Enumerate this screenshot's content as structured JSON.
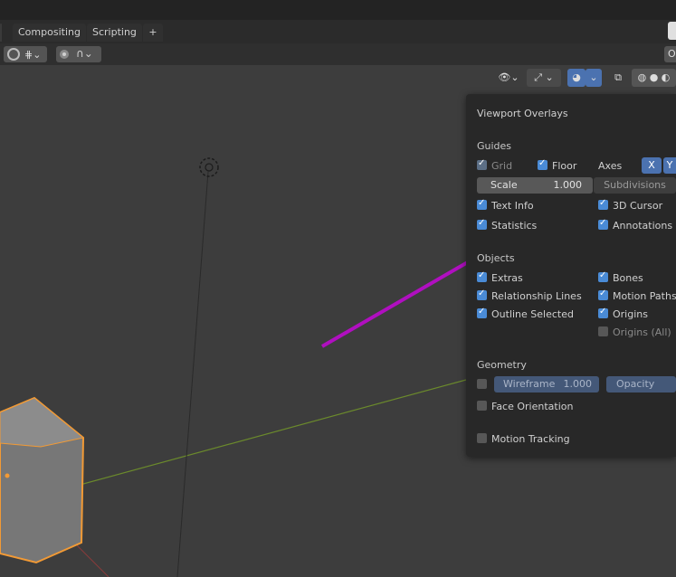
{
  "tabs": [
    "Compositing",
    "Scripting",
    "+"
  ],
  "toolbar": {
    "right_label": "O"
  },
  "overlays": {
    "title": "Viewport Overlays",
    "guides": {
      "header": "Guides",
      "grid": "Grid",
      "floor": "Floor",
      "axes": "Axes",
      "axis_x": "X",
      "axis_y": "Y",
      "scale_label": "Scale",
      "scale_value": "1.000",
      "subdivisions": "Subdivisions",
      "text_info": "Text Info",
      "cursor_3d": "3D Cursor",
      "statistics": "Statistics",
      "annotations": "Annotations"
    },
    "objects": {
      "header": "Objects",
      "extras": "Extras",
      "bones": "Bones",
      "relationship_lines": "Relationship Lines",
      "motion_paths": "Motion Paths",
      "outline_selected": "Outline Selected",
      "origins": "Origins",
      "origins_all": "Origins (All)"
    },
    "geometry": {
      "header": "Geometry",
      "wireframe_label": "Wireframe",
      "wireframe_value": "1.000",
      "opacity": "Opacity",
      "face_orientation": "Face Orientation"
    },
    "motion_tracking": "Motion Tracking"
  },
  "colors": {
    "accent": "#4b72b0",
    "checkbox": "#4a8bd6",
    "arrow": "#b00fc0",
    "selection": "#f29a35"
  }
}
